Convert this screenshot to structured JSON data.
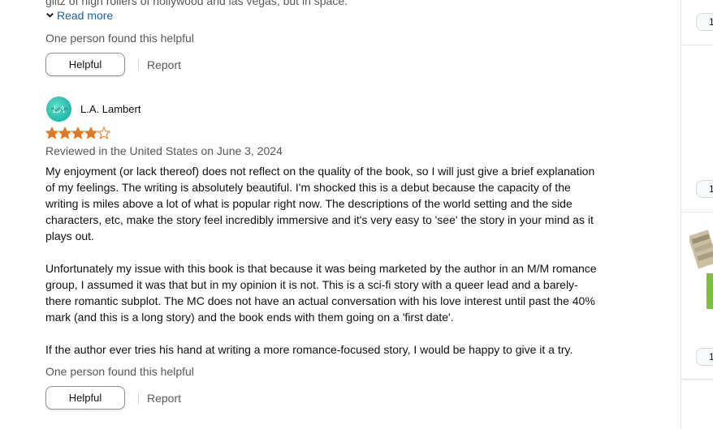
{
  "review_prev": {
    "clipped_text": "glitz of high rollers of hollywood and las vegas, but in space.",
    "read_more": "Read more",
    "helpful_count": "One person found this helpful",
    "helpful_button": "Helpful",
    "report_link": "Report"
  },
  "review": {
    "reviewer_name": "L.A. Lambert",
    "avatar_initials": "LA",
    "rating": 4,
    "rating_max": 5,
    "date": "Reviewed in the United States on June 3, 2024",
    "paragraphs": [
      "My enjoyment (or lack thereof) does not reflect on the quality of the book, so I will just give a brief explanation of my feelings. The writing is absolutely beautiful. I'm shocked this is a debut because the capacity of the writing is miles above a lot of what is popular right now. The descriptions of the world setting and the side characters, etc, make the story feel incredibly immersive and it's very easy to 'see' the story in your mind as it plays out.",
      "Unfortunately my issue with this book is that because it was being marketed by the author in an M/M romance group, I assumed it was that but in my opinion it is not. This is a sci-fi story with a queer lead and a barely-there romantic subplot. The MC does not have an actual conversation with his love interest until past the 40% mark (and this is a long story) and the book ends with them going on a 'first date'.",
      "If the author ever tries his hand at writing a more romance-focused story, I would be happy to give it a try."
    ],
    "helpful_count": "One person found this helpful",
    "helpful_button": "Helpful",
    "report_link": "Report"
  },
  "sidebar": {
    "pills": [
      "1",
      "1",
      "1"
    ]
  },
  "colors": {
    "star": "#de7921",
    "link": "#2162a1",
    "muted": "#565959"
  }
}
